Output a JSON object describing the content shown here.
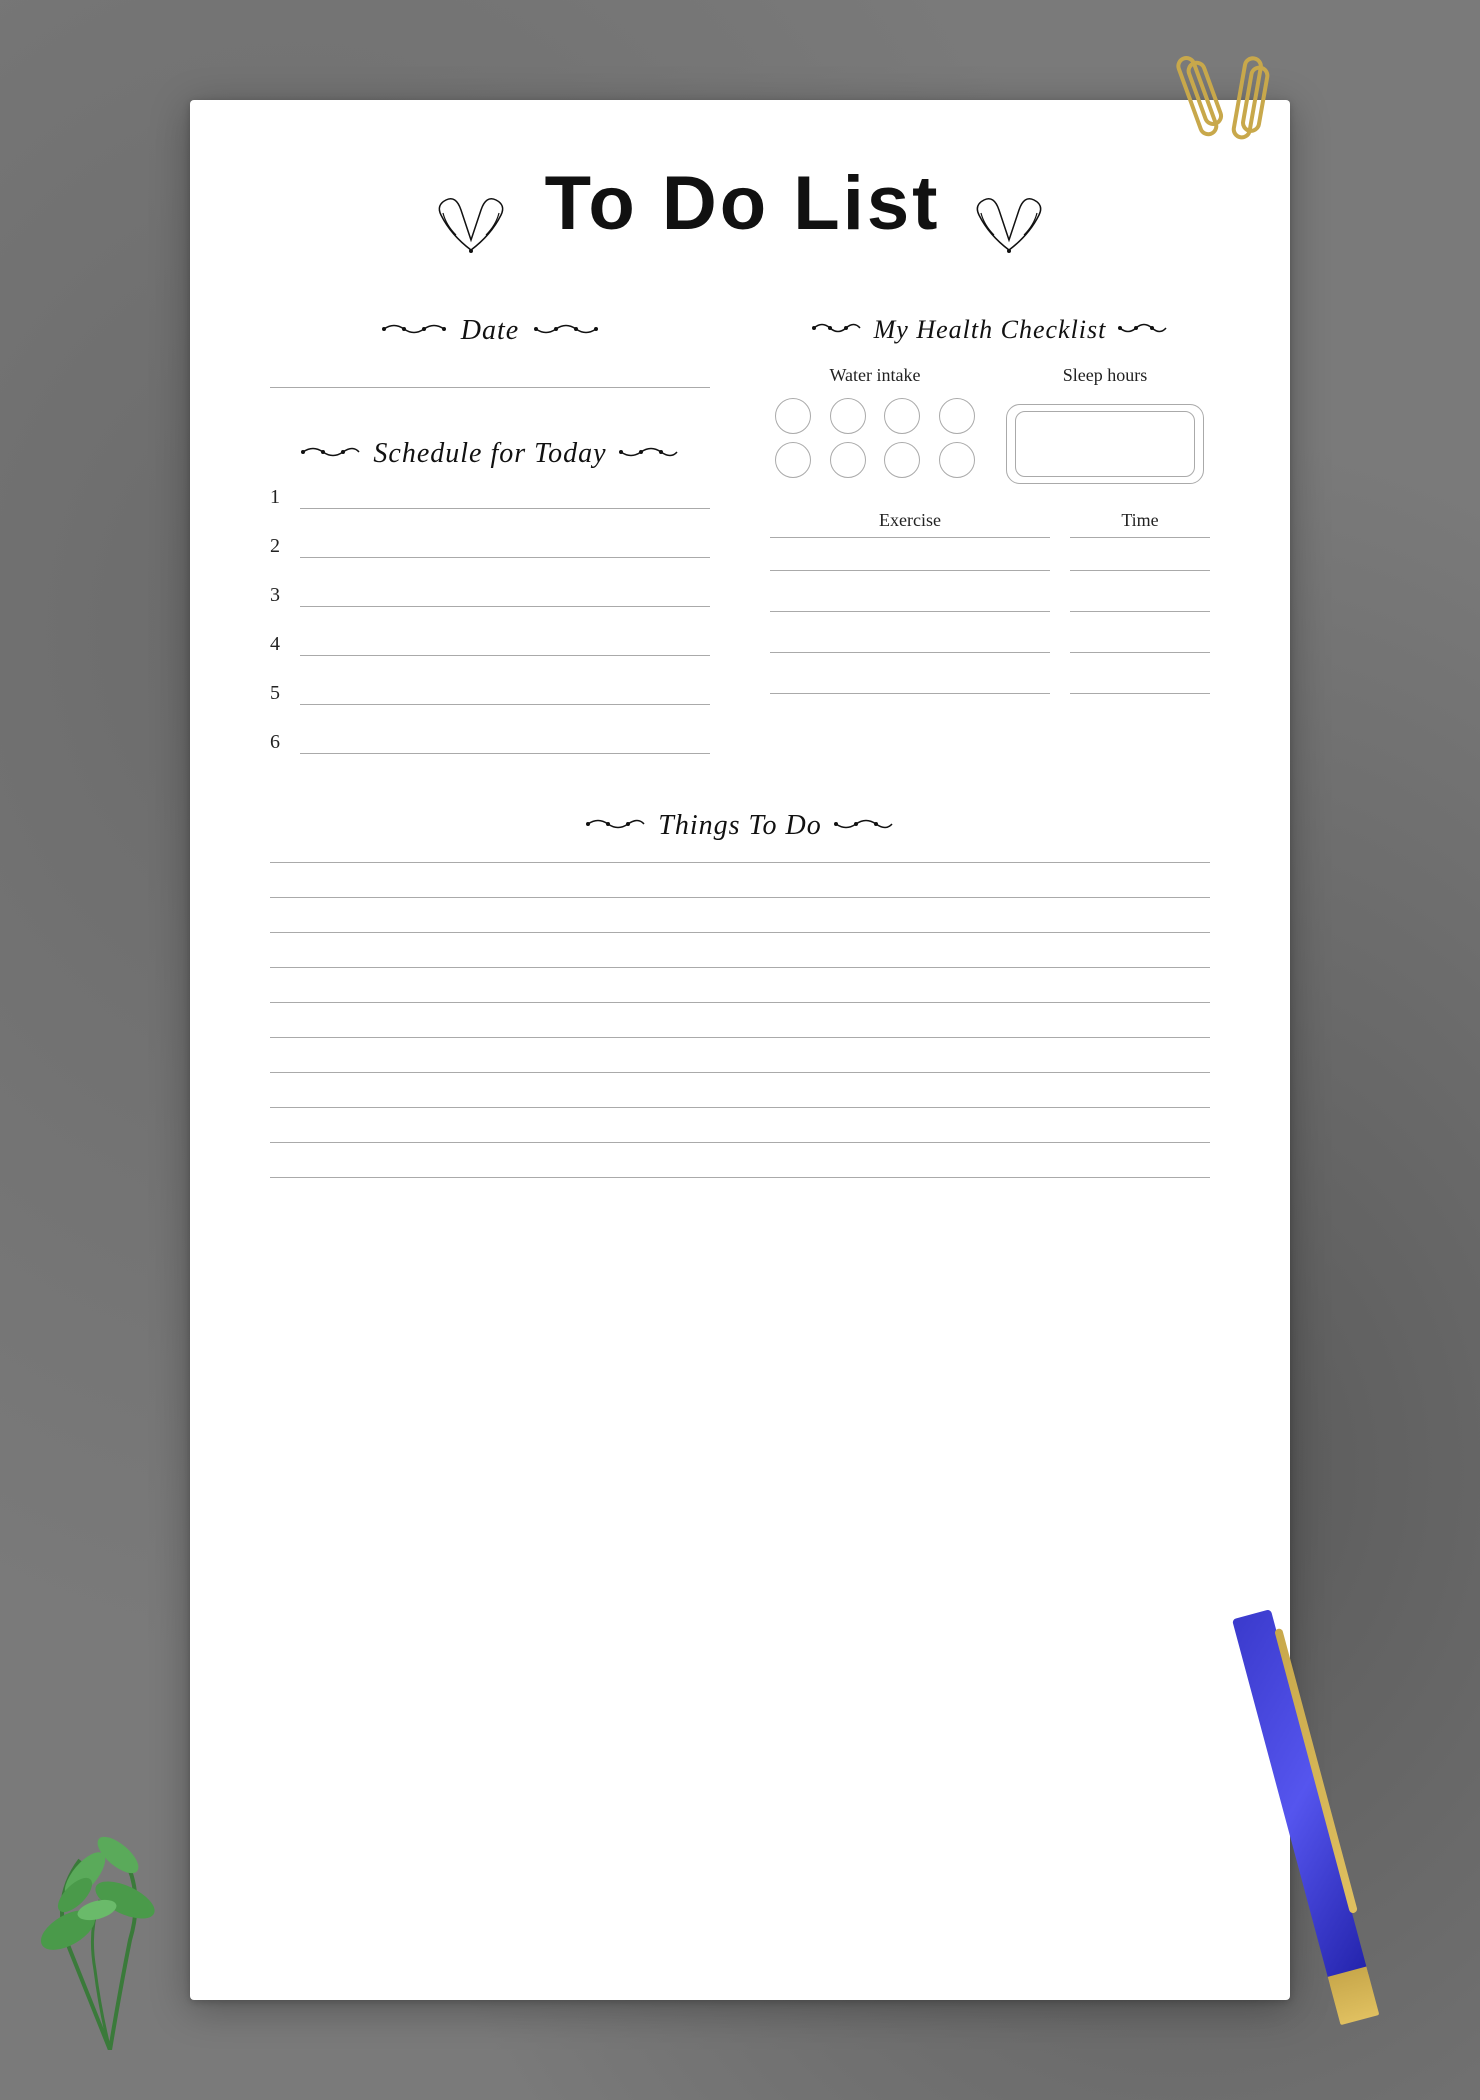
{
  "title": "To Do List",
  "sections": {
    "date": {
      "label": "Date",
      "laurel_left": "❧❧",
      "laurel_right": "❧❧"
    },
    "schedule": {
      "label": "Schedule for Today",
      "items": [
        "1",
        "2",
        "3",
        "4",
        "5",
        "6"
      ]
    },
    "health": {
      "label": "My Health Checklist",
      "water_label": "Water intake",
      "sleep_label": "Sleep hours",
      "exercise_label": "Exercise",
      "time_label": "Time",
      "exercise_rows": 4
    },
    "things": {
      "label": "Things To Do",
      "lines": 10
    }
  },
  "decoration": {
    "leaf_left": "🌿",
    "leaf_right": "🌿"
  }
}
